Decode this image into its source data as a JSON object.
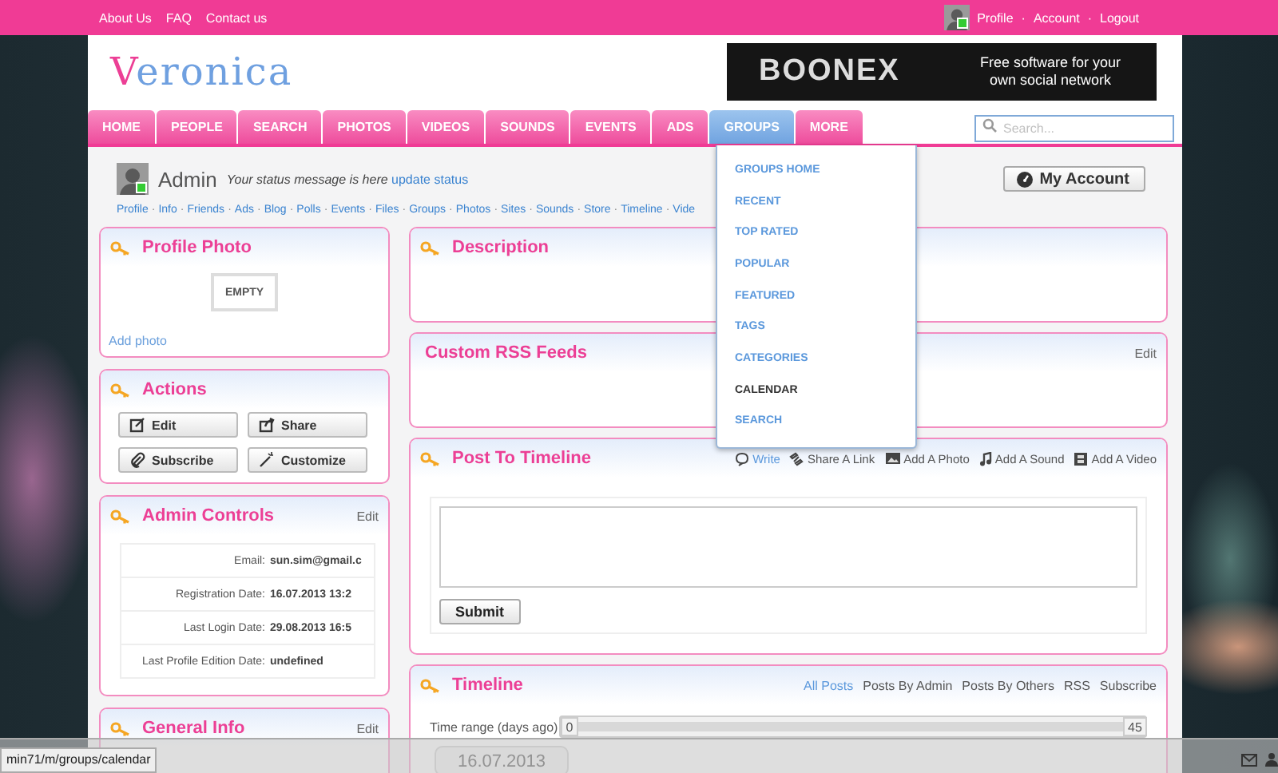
{
  "top_links": [
    "About Us",
    "FAQ",
    "Contact us"
  ],
  "user_bar": {
    "online": true,
    "separator": "·",
    "links": [
      "Profile",
      "Account",
      "Logout"
    ]
  },
  "logo": "Veronica",
  "banner": {
    "brand": "BOONEX",
    "tagline": "Free software for your own social network"
  },
  "nav": [
    {
      "label": "HOME",
      "selected": false
    },
    {
      "label": "PEOPLE",
      "selected": false
    },
    {
      "label": "SEARCH",
      "selected": false
    },
    {
      "label": "PHOTOS",
      "selected": false
    },
    {
      "label": "VIDEOS",
      "selected": false
    },
    {
      "label": "SOUNDS",
      "selected": false
    },
    {
      "label": "EVENTS",
      "selected": false
    },
    {
      "label": "ADS",
      "selected": false
    },
    {
      "label": "GROUPS",
      "selected": true
    },
    {
      "label": "MORE",
      "selected": false
    }
  ],
  "search": {
    "placeholder": "Search..."
  },
  "profile": {
    "name": "Admin",
    "online": true,
    "status": "Your status message is here",
    "status_link": "update status",
    "account_button": "My Account",
    "separator": "·",
    "links": [
      "Profile",
      "Info",
      "Friends",
      "Ads",
      "Blog",
      "Polls",
      "Events",
      "Files",
      "Groups",
      "Photos",
      "Sites",
      "Sounds",
      "Store",
      "Timeline",
      "Vide"
    ]
  },
  "groups_menu": [
    {
      "label": "GROUPS HOME",
      "selected": false
    },
    {
      "label": "RECENT",
      "selected": false
    },
    {
      "label": "TOP RATED",
      "selected": false
    },
    {
      "label": "POPULAR",
      "selected": false
    },
    {
      "label": "FEATURED",
      "selected": false
    },
    {
      "label": "TAGS",
      "selected": false
    },
    {
      "label": "CATEGORIES",
      "selected": false
    },
    {
      "label": "CALENDAR",
      "selected": true
    },
    {
      "label": "SEARCH",
      "selected": false
    }
  ],
  "profile_photo": {
    "title": "Profile Photo",
    "placeholder": "EMPTY",
    "link": "Add photo"
  },
  "actions": {
    "title": "Actions",
    "buttons": [
      {
        "label": "Edit",
        "kind": "edit"
      },
      {
        "label": "Share",
        "kind": "share"
      },
      {
        "label": "Subscribe",
        "kind": "subscribe"
      },
      {
        "label": "Customize",
        "kind": "customize"
      }
    ]
  },
  "admin_controls": {
    "title": "Admin Controls",
    "edit": "Edit",
    "rows": [
      {
        "label": "Email:",
        "value": "sun.sim@gmail.c"
      },
      {
        "label": "Registration Date:",
        "value": "16.07.2013 13:2"
      },
      {
        "label": "Last Login Date:",
        "value": "29.08.2013 16:5"
      },
      {
        "label": "Last Profile Edition Date:",
        "value": "undefined"
      }
    ]
  },
  "general_info": {
    "title": "General Info",
    "edit": "Edit"
  },
  "description": {
    "title": "Description"
  },
  "rss": {
    "title": "Custom RSS Feeds",
    "edit": "Edit"
  },
  "post": {
    "title": "Post To Timeline",
    "tabs": [
      {
        "label": "Write",
        "kind": "write",
        "selected": true
      },
      {
        "label": "Share A Link",
        "kind": "link",
        "selected": false
      },
      {
        "label": "Add A Photo",
        "kind": "photo",
        "selected": false
      },
      {
        "label": "Add A Sound",
        "kind": "sound",
        "selected": false
      },
      {
        "label": "Add A Video",
        "kind": "video",
        "selected": false
      }
    ],
    "submit": "Submit"
  },
  "timeline": {
    "title": "Timeline",
    "filters": [
      {
        "label": "All Posts",
        "selected": true
      },
      {
        "label": "Posts By Admin",
        "selected": false
      },
      {
        "label": "Posts By Others",
        "selected": false
      },
      {
        "label": "RSS",
        "selected": false
      },
      {
        "label": "Subscribe",
        "selected": false
      }
    ],
    "range_label": "Time range (days ago)",
    "range_min": "0",
    "range_max": "45",
    "level": 1,
    "date": "16.07.2013"
  },
  "status_bar": {
    "url": "min71/m/groups/calendar"
  }
}
